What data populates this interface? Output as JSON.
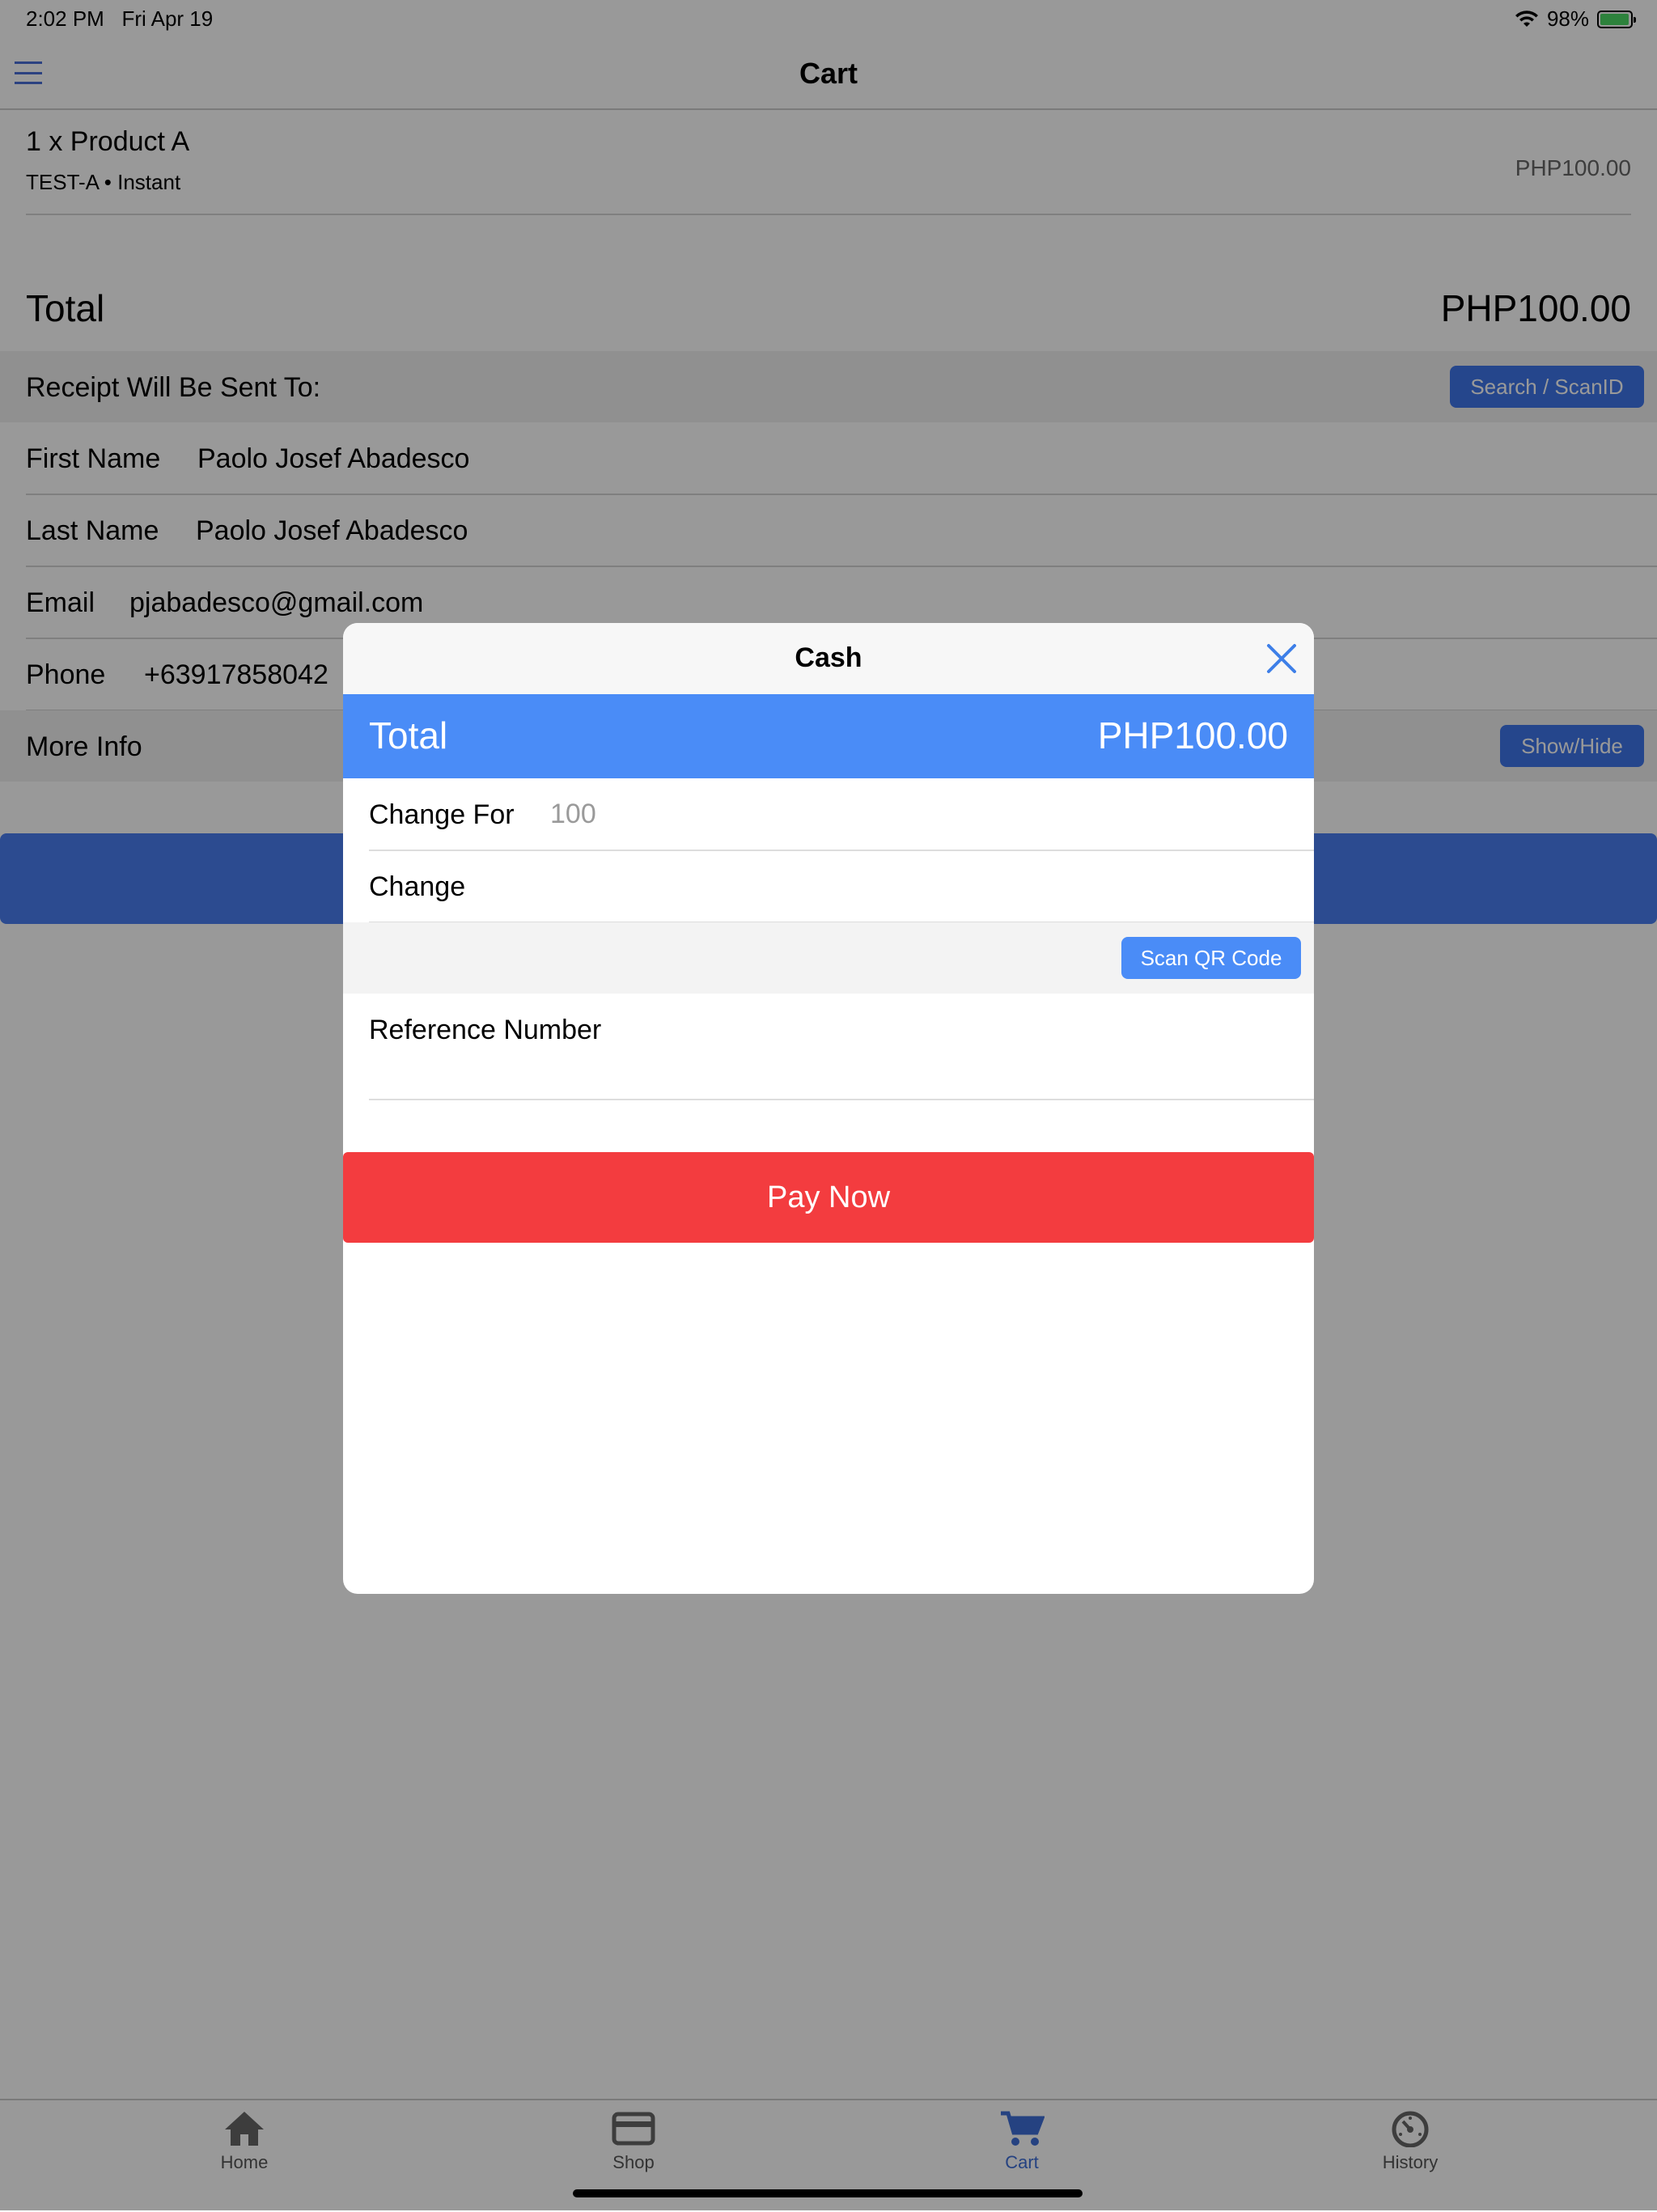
{
  "status": {
    "time": "2:02 PM",
    "date": "Fri Apr 19",
    "battery": "98%",
    "battery_level": 0.98
  },
  "nav": {
    "title": "Cart"
  },
  "cart": {
    "item_title": "1 x Product A",
    "item_subtitle": "TEST-A • Instant",
    "item_price": "PHP100.00",
    "total_label": "Total",
    "total_value": "PHP100.00"
  },
  "receipt": {
    "header": "Receipt Will Be Sent To:",
    "search_button": "Search / ScanID",
    "first_name_label": "First Name",
    "first_name_value": "Paolo Josef Abadesco",
    "last_name_label": "Last Name",
    "last_name_value": "Paolo Josef Abadesco",
    "email_label": "Email",
    "email_value": "pjabadesco@gmail.com",
    "phone_label": "Phone",
    "phone_value": "+63917858042",
    "more_info_label": "More Info",
    "show_hide_button": "Show/Hide"
  },
  "modal": {
    "title": "Cash",
    "total_label": "Total",
    "total_value": "PHP100.00",
    "change_for_label": "Change For",
    "change_for_placeholder": "100",
    "change_label": "Change",
    "scan_qr_button": "Scan QR Code",
    "reference_label": "Reference Number",
    "pay_button": "Pay Now"
  },
  "tabs": [
    {
      "label": "Home",
      "icon": "home-icon",
      "active": false
    },
    {
      "label": "Shop",
      "icon": "card-icon",
      "active": false
    },
    {
      "label": "Cart",
      "icon": "cart-icon",
      "active": true
    },
    {
      "label": "History",
      "icon": "history-icon",
      "active": false
    }
  ],
  "colors": {
    "accent": "#3e76ea",
    "modal_total_bg": "#4a8cf7",
    "pay_button": "#f33c3f",
    "active_tab": "#3e6fd8"
  }
}
